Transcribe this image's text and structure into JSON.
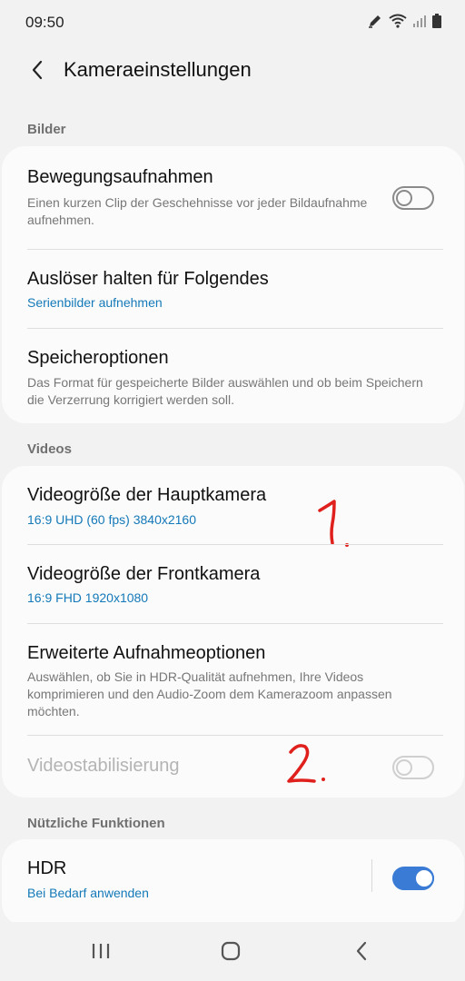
{
  "status_bar": {
    "time": "09:50",
    "icons": [
      "edit-pen-icon",
      "wifi-icon",
      "signal-icon",
      "battery-icon"
    ]
  },
  "header": {
    "title": "Kameraeinstellungen"
  },
  "sections": {
    "bilder": {
      "label": "Bilder",
      "items": [
        {
          "title": "Bewegungsaufnahmen",
          "subtitle": "Einen kurzen Clip der Geschehnisse vor jeder Bildaufnahme aufnehmen.",
          "toggle": "off"
        },
        {
          "title": "Auslöser halten für Folgendes",
          "value": "Serienbilder aufnehmen"
        },
        {
          "title": "Speicheroptionen",
          "subtitle": "Das Format für gespeicherte Bilder auswählen und ob beim Speichern die Verzerrung korrigiert werden soll."
        }
      ]
    },
    "videos": {
      "label": "Videos",
      "items": [
        {
          "title": "Videogröße der Hauptkamera",
          "value": "16:9 UHD (60 fps) 3840x2160"
        },
        {
          "title": "Videogröße der Frontkamera",
          "value": "16:9 FHD 1920x1080"
        },
        {
          "title": "Erweiterte Aufnahmeoptionen",
          "subtitle": "Auswählen, ob Sie in HDR-Qualität aufnehmen, Ihre Videos komprimieren und den Audio-Zoom dem Kamerazoom anpassen möchten."
        },
        {
          "title": "Videostabilisierung",
          "toggle": "off",
          "disabled": true
        }
      ]
    },
    "nuetzliche": {
      "label": "Nützliche Funktionen",
      "items": [
        {
          "title": "HDR",
          "value": "Bei Bedarf anwenden",
          "toggle": "on"
        }
      ]
    }
  },
  "annotations": [
    "1.",
    "2."
  ],
  "colors": {
    "accent": "#1479b8",
    "toggle_on": "#3a7bd5",
    "annotation": "#e0201c"
  },
  "nav_bar": [
    "recent-apps-icon",
    "home-icon",
    "back-icon"
  ]
}
